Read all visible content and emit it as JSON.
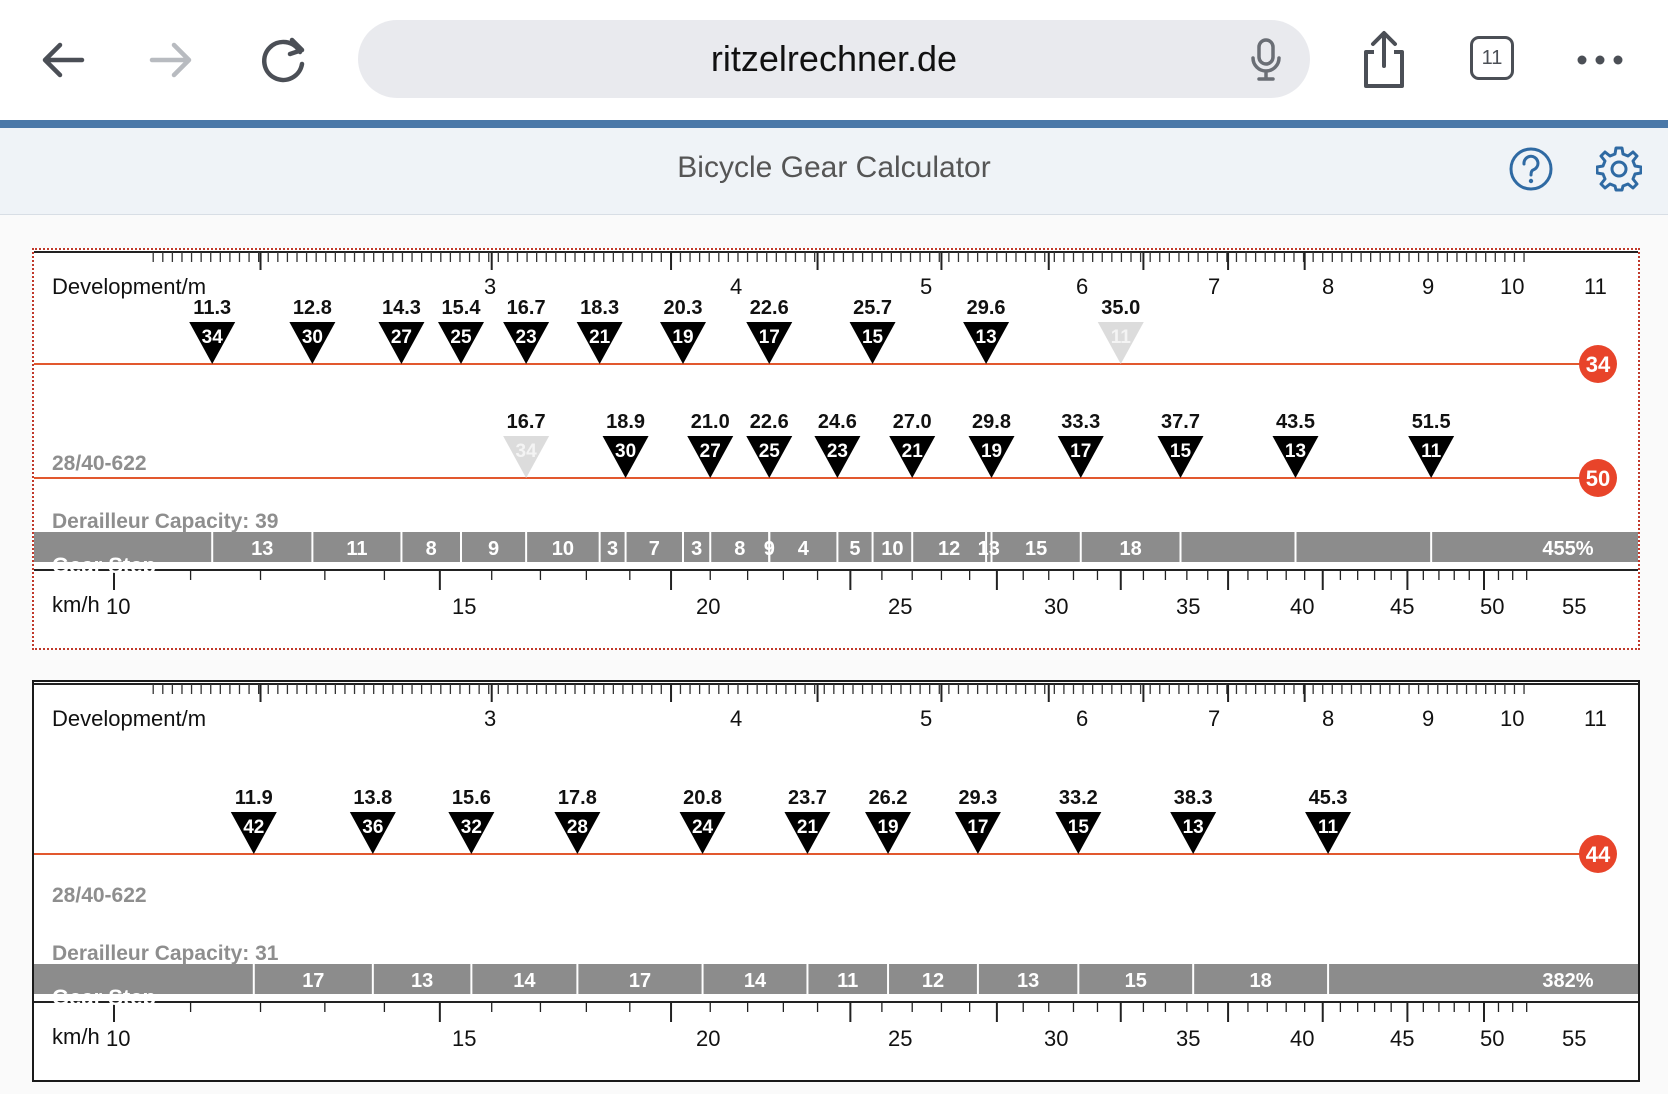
{
  "browser": {
    "url": "ritzelrechner.de",
    "tab_count": "11"
  },
  "app": {
    "title": "Bicycle Gear Calculator"
  },
  "dev_scale": {
    "label": "Development/m",
    "ticks": [
      "3",
      "4",
      "5",
      "6",
      "7",
      "8",
      "9",
      "10",
      "11"
    ]
  },
  "speed_scale": {
    "label": "km/h",
    "ticks": [
      "10",
      "15",
      "20",
      "25",
      "30",
      "35",
      "40",
      "45",
      "50",
      "55"
    ]
  },
  "panels": [
    {
      "tire": "28/40-622",
      "derailleur": "Derailleur Capacity: 39",
      "gear_step_label": "Gear Step",
      "gear_step_total": "455%",
      "chainrings": [
        {
          "teeth": "34",
          "cogs": [
            {
              "cog": "34",
              "dev": "11.3",
              "faded": false
            },
            {
              "cog": "30",
              "dev": "12.8",
              "faded": false
            },
            {
              "cog": "27",
              "dev": "14.3",
              "faded": false
            },
            {
              "cog": "25",
              "dev": "15.4",
              "faded": false
            },
            {
              "cog": "23",
              "dev": "16.7",
              "faded": false
            },
            {
              "cog": "21",
              "dev": "18.3",
              "faded": false
            },
            {
              "cog": "19",
              "dev": "20.3",
              "faded": false
            },
            {
              "cog": "17",
              "dev": "22.6",
              "faded": false
            },
            {
              "cog": "15",
              "dev": "25.7",
              "faded": false
            },
            {
              "cog": "13",
              "dev": "29.6",
              "faded": false
            },
            {
              "cog": "11",
              "dev": "35.0",
              "faded": true
            }
          ]
        },
        {
          "teeth": "50",
          "cogs": [
            {
              "cog": "34",
              "dev": "16.7",
              "faded": true
            },
            {
              "cog": "30",
              "dev": "18.9",
              "faded": false
            },
            {
              "cog": "27",
              "dev": "21.0",
              "faded": false
            },
            {
              "cog": "25",
              "dev": "22.6",
              "faded": false
            },
            {
              "cog": "23",
              "dev": "24.6",
              "faded": false
            },
            {
              "cog": "21",
              "dev": "27.0",
              "faded": false
            },
            {
              "cog": "19",
              "dev": "29.8",
              "faded": false
            },
            {
              "cog": "17",
              "dev": "33.3",
              "faded": false
            },
            {
              "cog": "15",
              "dev": "37.7",
              "faded": false
            },
            {
              "cog": "13",
              "dev": "43.5",
              "faded": false
            },
            {
              "cog": "11",
              "dev": "51.5",
              "faded": false
            }
          ]
        }
      ],
      "gear_steps": [
        "13",
        "11",
        "8",
        "9",
        "10",
        "3",
        "7",
        "3",
        "8",
        "9",
        "4",
        "5",
        "10",
        "12",
        "13",
        "15",
        "18"
      ]
    },
    {
      "tire": "28/40-622",
      "derailleur": "Derailleur Capacity: 31",
      "gear_step_label": "Gear Step",
      "gear_step_total": "382%",
      "chainrings": [
        {
          "teeth": "44",
          "cogs": [
            {
              "cog": "42",
              "dev": "11.9",
              "faded": false
            },
            {
              "cog": "36",
              "dev": "13.8",
              "faded": false
            },
            {
              "cog": "32",
              "dev": "15.6",
              "faded": false
            },
            {
              "cog": "28",
              "dev": "17.8",
              "faded": false
            },
            {
              "cog": "24",
              "dev": "20.8",
              "faded": false
            },
            {
              "cog": "21",
              "dev": "23.7",
              "faded": false
            },
            {
              "cog": "19",
              "dev": "26.2",
              "faded": false
            },
            {
              "cog": "17",
              "dev": "29.3",
              "faded": false
            },
            {
              "cog": "15",
              "dev": "33.2",
              "faded": false
            },
            {
              "cog": "13",
              "dev": "38.3",
              "faded": false
            },
            {
              "cog": "11",
              "dev": "45.3",
              "faded": false
            }
          ]
        }
      ],
      "gear_steps": [
        "17",
        "13",
        "14",
        "17",
        "14",
        "11",
        "12",
        "13",
        "15",
        "18"
      ]
    }
  ]
}
